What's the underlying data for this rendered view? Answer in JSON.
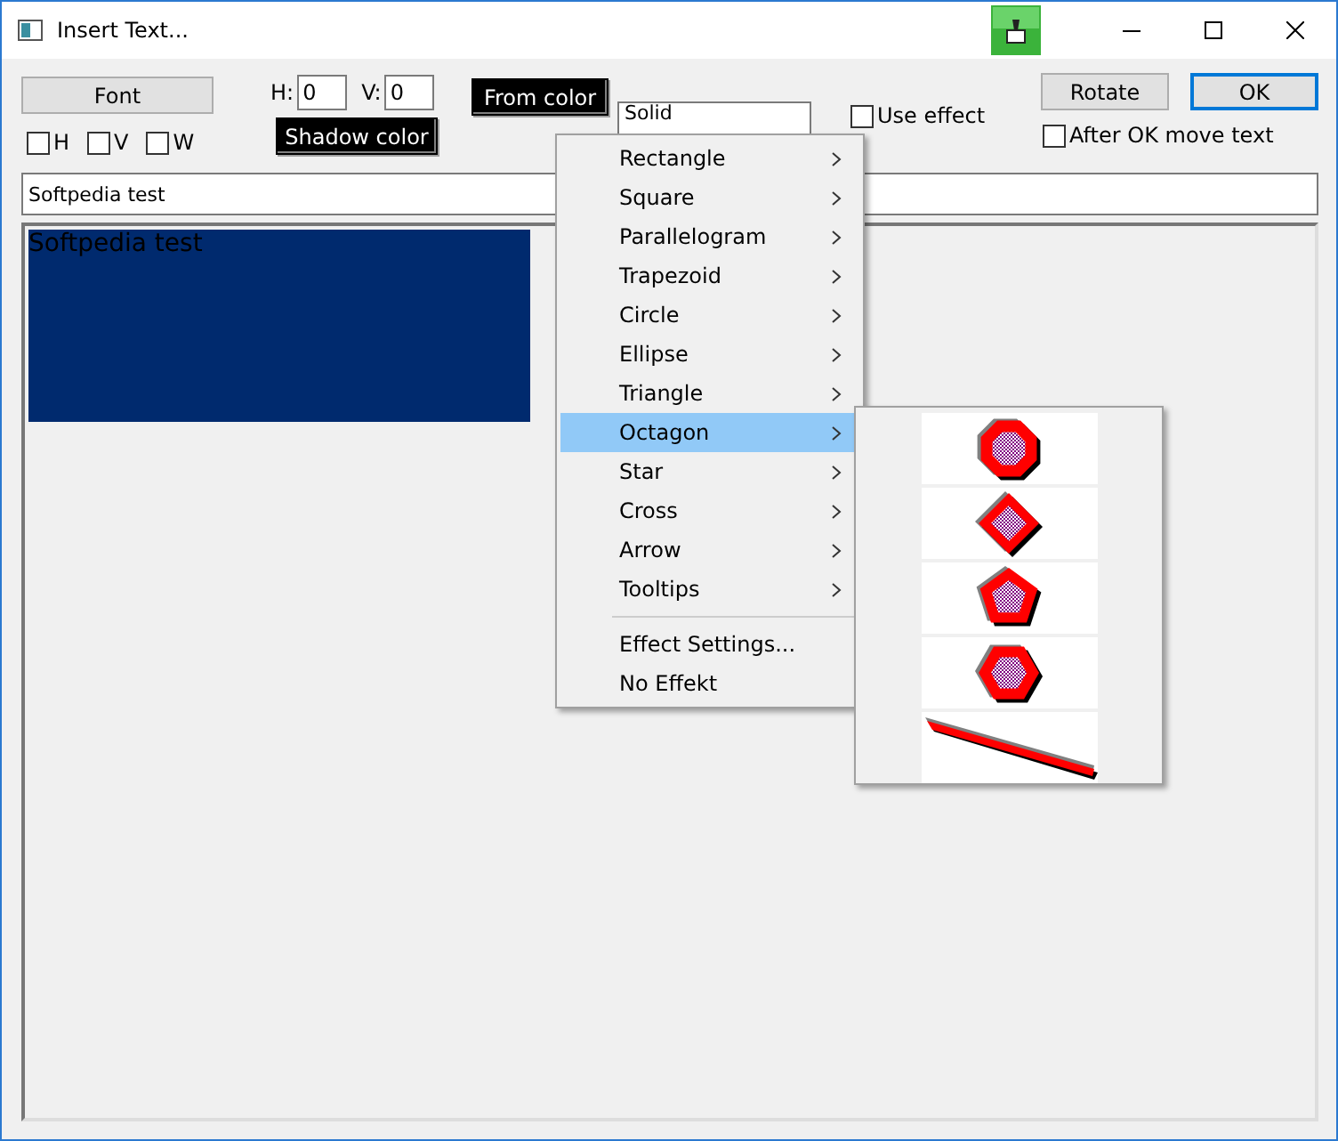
{
  "window": {
    "title": "Insert Text..."
  },
  "toolbar": {
    "font_button": "Font",
    "flips": [
      {
        "label": "H",
        "checked": false
      },
      {
        "label": "V",
        "checked": false
      },
      {
        "label": "W",
        "checked": false
      }
    ],
    "h_label": "H:",
    "h_value": "0",
    "v_label": "V:",
    "v_value": "0",
    "shadow_color_button": "Shadow color",
    "from_color_button": "From color",
    "style_select": "Solid",
    "use_effect": {
      "label": "Use effect",
      "checked": false
    },
    "rotate_button": "Rotate",
    "ok_button": "OK",
    "after_ok": {
      "label": "After OK move text",
      "checked": false
    }
  },
  "text_field": {
    "value": "Softpedia test"
  },
  "preview": {
    "text": "Softpedia test"
  },
  "menu": {
    "items": [
      {
        "kind": "submenu",
        "label": "Rectangle",
        "selected": false
      },
      {
        "kind": "submenu",
        "label": "Square",
        "selected": false
      },
      {
        "kind": "submenu",
        "label": "Parallelogram",
        "selected": false
      },
      {
        "kind": "submenu",
        "label": "Trapezoid",
        "selected": false
      },
      {
        "kind": "submenu",
        "label": "Circle",
        "selected": false
      },
      {
        "kind": "submenu",
        "label": "Ellipse",
        "selected": false
      },
      {
        "kind": "submenu",
        "label": "Triangle",
        "selected": false
      },
      {
        "kind": "submenu",
        "label": "Octagon",
        "selected": true
      },
      {
        "kind": "submenu",
        "label": "Star",
        "selected": false
      },
      {
        "kind": "submenu",
        "label": "Cross",
        "selected": false
      },
      {
        "kind": "submenu",
        "label": "Arrow",
        "selected": false
      },
      {
        "kind": "submenu",
        "label": "Tooltips",
        "selected": false
      },
      {
        "kind": "separator"
      },
      {
        "kind": "command",
        "label": "Effect Settings...",
        "selected": false
      },
      {
        "kind": "command",
        "label": "No Effekt",
        "selected": false
      }
    ],
    "submenu": [
      {
        "kind": "octagon"
      },
      {
        "kind": "diamond"
      },
      {
        "kind": "pentagon"
      },
      {
        "kind": "hexagon"
      },
      {
        "kind": "line"
      }
    ]
  }
}
